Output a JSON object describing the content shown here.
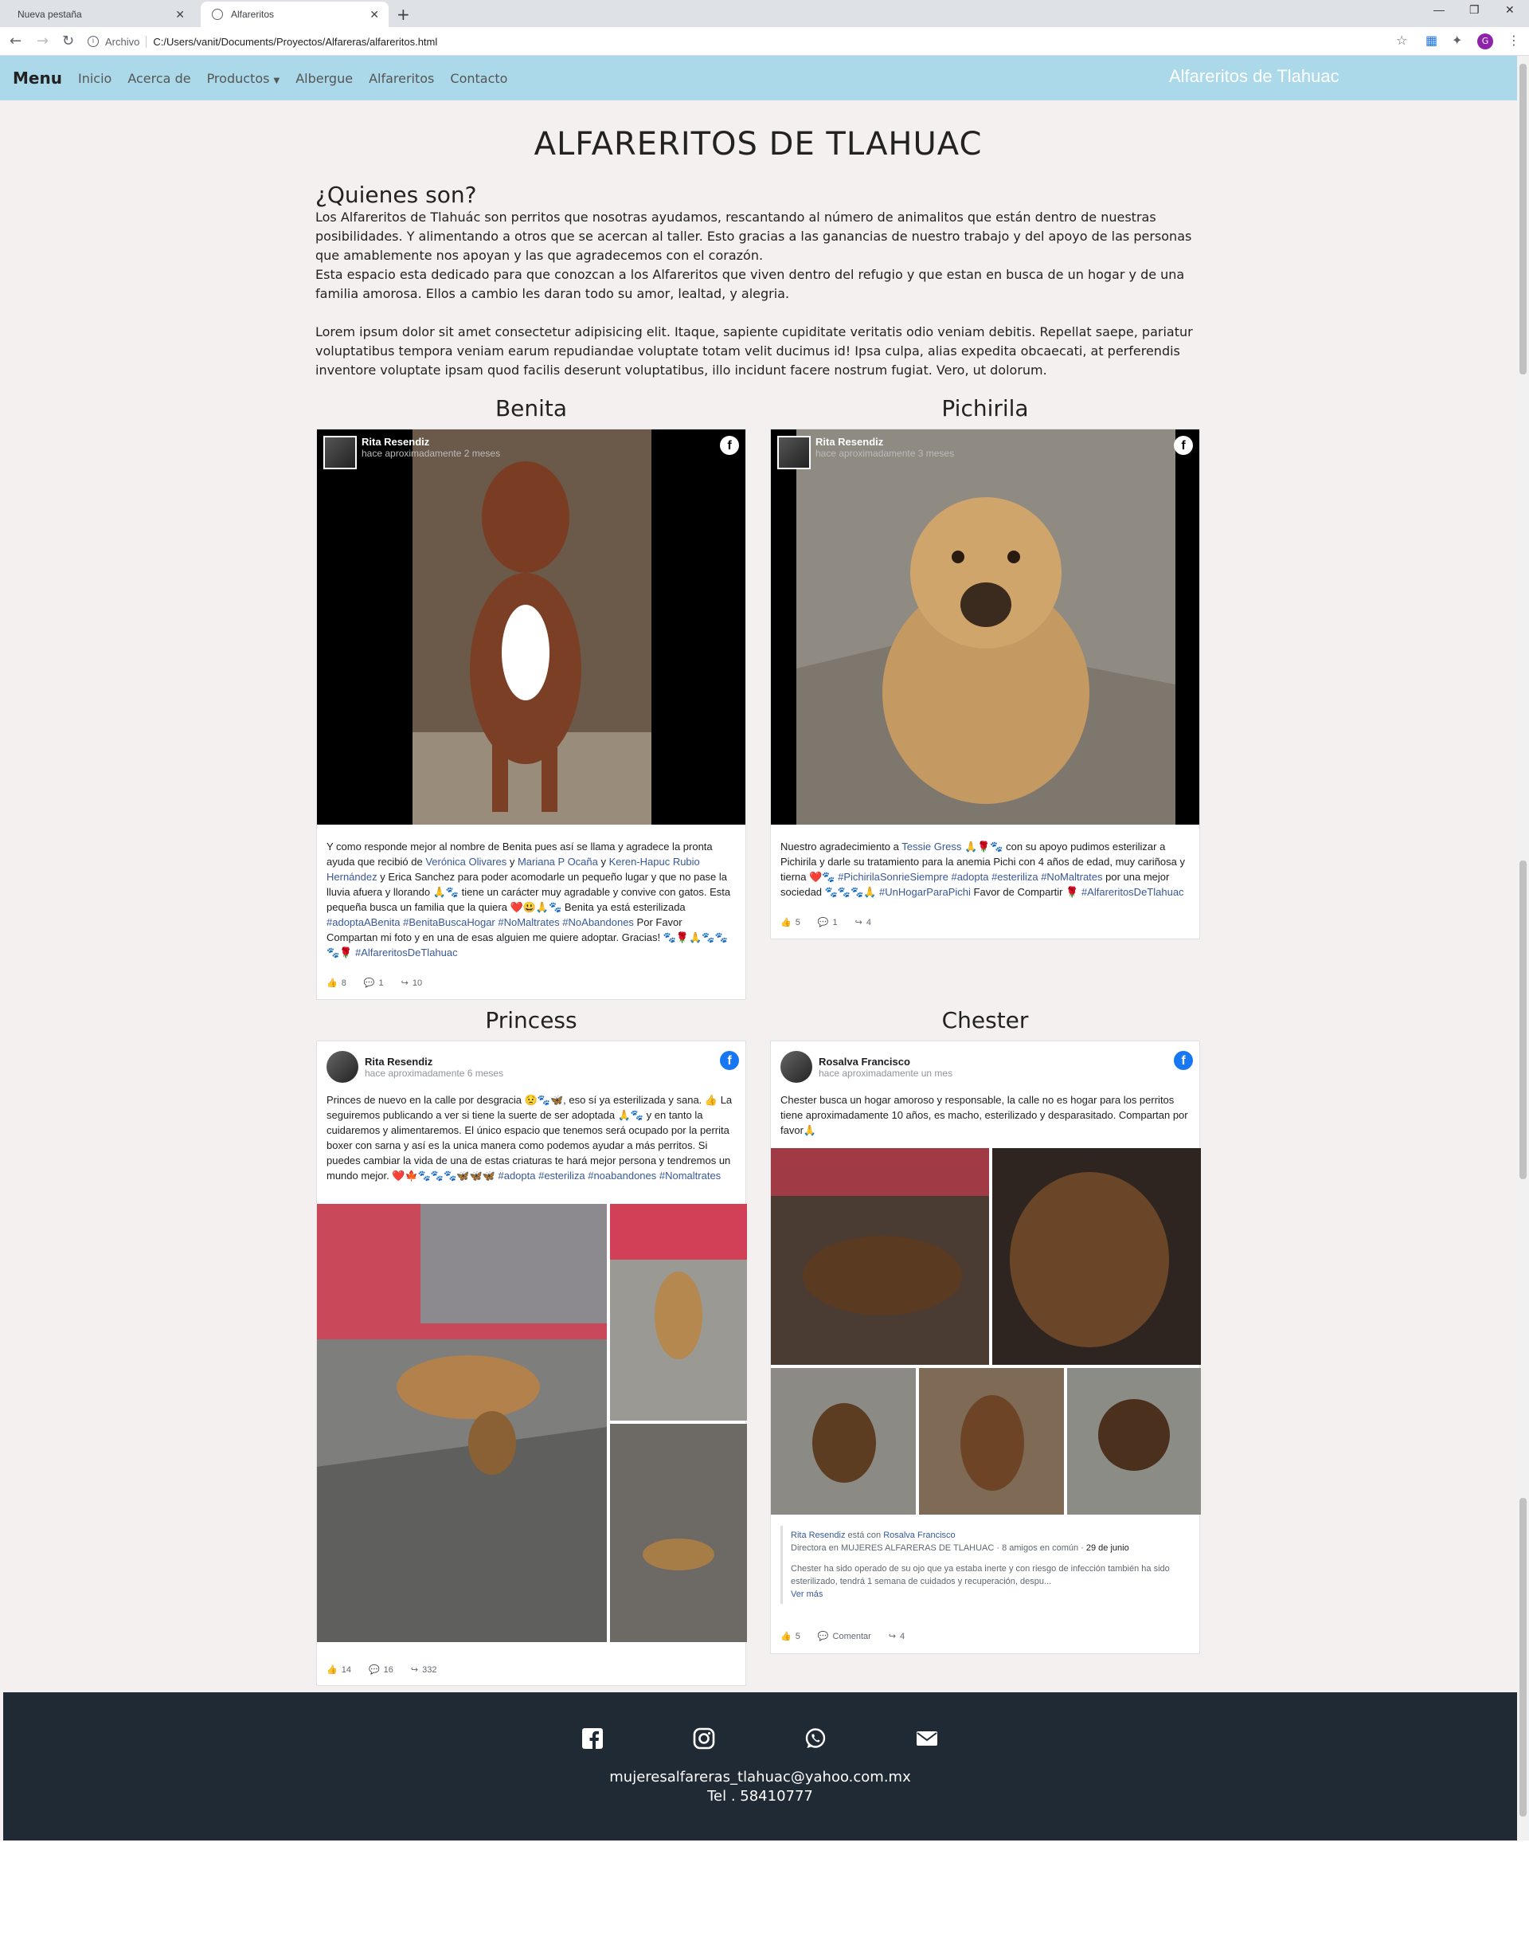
{
  "browser": {
    "tabs": [
      {
        "label": "Nueva pestaña"
      },
      {
        "label": "Alfareritos"
      }
    ],
    "new_tab": "+",
    "archivo": "Archivo",
    "url": "C:/Users/vanit/Documents/Proyectos/Alfareras/alfareritos.html",
    "profile_initial": "G"
  },
  "nav": {
    "brand": "Menu",
    "links": [
      "Inicio",
      "Acerca de",
      "Productos",
      "Albergue",
      "Alfareritos",
      "Contacto"
    ],
    "site_title": "Alfareritos de Tlahuac"
  },
  "page": {
    "title": "ALFARERITOS DE TLAHUAC",
    "subtitle": "¿Quienes son?",
    "para1": "Los Alfareritos de Tlahuác son perritos que nosotras ayudamos, rescantando al número de animalitos que están dentro de nuestras posibilidades. Y alimentando a otros que se acercan al taller. Esto gracias a las ganancias de nuestro trabajo y del apoyo de las personas que amablemente nos apoyan y las que agradecemos con el corazón.",
    "para2": "Esta espacio esta dedicado para que conozcan a los Alfareritos que viven dentro del refugio y que estan en busca de un hogar y de una familia amorosa. Ellos a cambio les daran todo su amor, lealtad, y alegria.",
    "para3": "Lorem ipsum dolor sit amet consectetur adipisicing elit. Itaque, sapiente cupiditate veritatis odio veniam debitis. Repellat saepe, pariatur voluptatibus tempora veniam earum repudiandae voluptate totam velit ducimus id! Ipsa culpa, alias expedita obcaecati, at perferendis inventore voluptate ipsam quod facilis deserunt voluptatibus, illo incidunt facere nostrum fugiat. Vero, ut dolorum."
  },
  "dogs": {
    "benita": {
      "name": "Benita",
      "author": "Rita Resendiz",
      "time": "hace aproximadamente 2 meses",
      "text_a": "Y como responde mejor al nombre de Benita pues así se llama y agradece la pronta ayuda que recibió de ",
      "link1": "Verónica Olivares",
      "y1": " y ",
      "link2": "Mariana P Ocaña",
      "y2": " y ",
      "link3": "Keren-Hapuc Rubio Hernández",
      "text_b": " y Erica Sanchez para poder acomodarle un pequeño lugar y que no pase la lluvia afuera y llorando 🙏🐾 tiene un carácter muy agradable y convive con gatos. Esta pequeña busca un familia que la quiera ❤️😃🙏🐾 Benita ya está esterilizada ",
      "tags1": "#adoptaABenita #BenitaBuscaHogar #NoMaltrates #NoAbandones",
      "text_c": " Por Favor Compartan mi foto y en una de esas alguien me quiere adoptar. Gracias! 🐾🌹🙏🐾🐾🐾🌹 ",
      "tags2": "#AlfareritosDeTlahuac",
      "likes": "8",
      "comments": "1",
      "shares": "10"
    },
    "pichirila": {
      "name": "Pichirila",
      "author": "Rita Resendiz",
      "time": "hace aproximadamente 3 meses",
      "text_a": "Nuestro agradecimiento a ",
      "link1": "Tessie Gress",
      "text_b": " 🙏🌹🐾 con su apoyo pudimos esterilizar a Pichirila y darle su tratamiento para la anemia Pichi con 4 años de edad, muy cariñosa y tierna ❤️🐾 ",
      "tags1": "#PichirilaSonrieSiempre #adopta #esteriliza #NoMaltrates",
      "text_c": " por una mejor sociedad 🐾🐾🐾🙏 ",
      "tags2": "#UnHogarParaPichi",
      "text_d": " Favor de Compartir 🌹 ",
      "tags3": "#AlfareritosDeTlahuac",
      "likes": "5",
      "comments": "1",
      "shares": "4"
    },
    "princess": {
      "name": "Princess",
      "author": "Rita Resendiz",
      "time": "hace aproximadamente 6 meses",
      "text_a": "Princes de nuevo en la calle por desgracia 😟🐾🦋, eso sí ya esterilizada y sana. 👍 La seguiremos publicando a ver si tiene la suerte de ser adoptada 🙏🐾 y en tanto la cuidaremos y alimentaremos. El único espacio que tenemos será ocupado por la perrita boxer con sarna y así es la unica manera como podemos ayudar a más perritos. Si puedes cambiar la vida de una de estas criaturas te hará mejor persona y tendremos un mundo mejor. ❤️🍁🐾🐾🐾🦋🦋🦋 ",
      "tags1": "#adopta #esteriliza #noabandones #Nomaltrates",
      "likes": "14",
      "comments": "16",
      "shares": "332"
    },
    "chester": {
      "name": "Chester",
      "author": "Rosalva Francisco",
      "time": "hace aproximadamente un mes",
      "text_a": "Chester busca un hogar amoroso y responsable, la calle no es hogar para los perritos tiene aproximadamente 10 años, es macho, esterilizado y desparasitado. Compartan por favor🙏",
      "shared_author": "Rita Resendiz",
      "shared_with": " está con ",
      "shared_with_name": "Rosalva Francisco",
      "shared_meta": "Directora en MUJERES ALFARERAS DE TLAHUAC · 8 amigos en común · ",
      "shared_date": "29 de junio",
      "shared_text": "Chester ha sido operado de su ojo que ya estaba inerte y con riesgo de infección también ha sido esterilizado, tendrá 1 semana de cuidados y recuperación, despu...",
      "ver_mas": "Ver más",
      "likes": "5",
      "comment_label": "Comentar",
      "shares": "4"
    }
  },
  "footer": {
    "email": "mujeresalfareras_tlahuac@yahoo.com.mx",
    "tel": "Tel . 58410777"
  }
}
